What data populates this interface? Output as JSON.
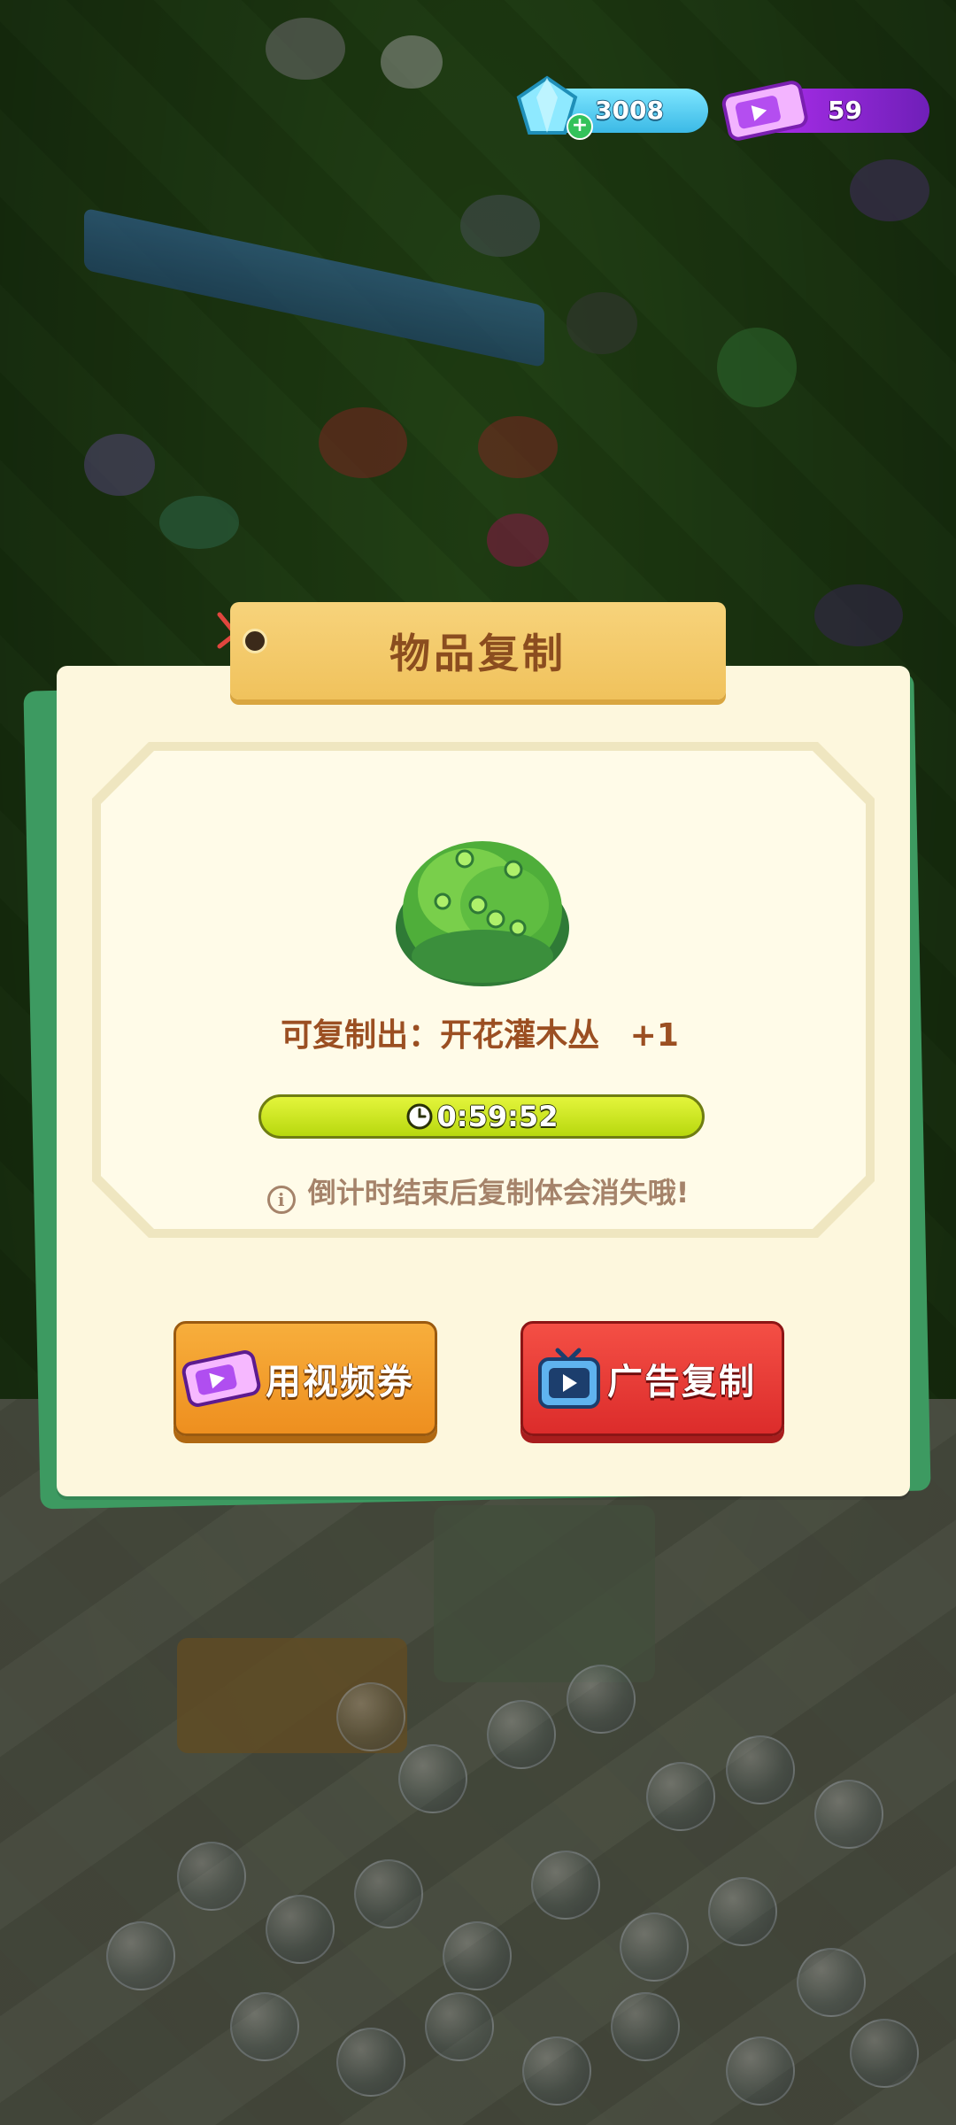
{
  "resources": {
    "gems": "3008",
    "tickets": "59"
  },
  "dialog": {
    "title": "物品复制",
    "copy_label": "可复制出：开花灌木丛",
    "copy_amount": "+1",
    "timer": "0:59:52",
    "notice": "倒计时结束后复制体会消失哦!",
    "video_button": "用视频券",
    "ad_button": "广告复制"
  },
  "colors": {
    "dialog_bg": "#fdf7dd",
    "title_tag": "#f0c25c",
    "timer_bar": "#c6e21f",
    "video_button": "#ee8f1f",
    "ad_button": "#dc2c2b"
  },
  "icons": [
    "gem-icon",
    "plus-icon",
    "ticket-icon",
    "bush-item-icon",
    "clock-icon",
    "info-icon",
    "video-ticket-icon",
    "tv-icon"
  ]
}
